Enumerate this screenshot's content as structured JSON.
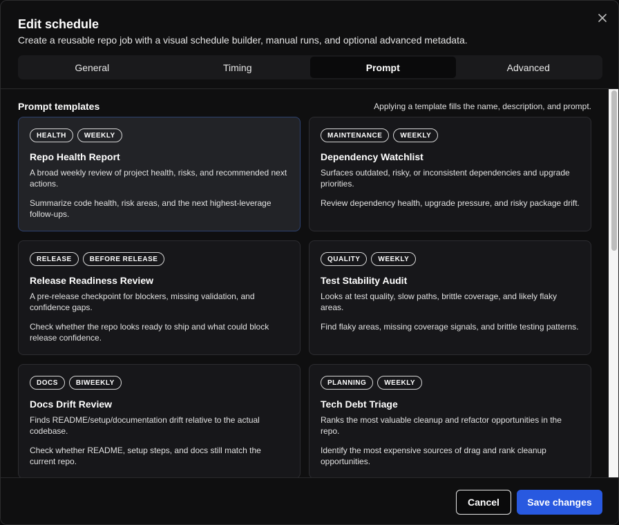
{
  "dialog": {
    "title": "Edit schedule",
    "subtitle": "Create a reusable repo job with a visual schedule builder, manual runs, and optional advanced metadata.",
    "close_icon": "close-icon"
  },
  "tabs": [
    {
      "label": "General",
      "active": false
    },
    {
      "label": "Timing",
      "active": false
    },
    {
      "label": "Prompt",
      "active": true
    },
    {
      "label": "Advanced",
      "active": false
    }
  ],
  "templates_section": {
    "title": "Prompt templates",
    "note": "Applying a template fills the name, description, and prompt."
  },
  "templates": [
    {
      "tags": [
        "HEALTH",
        "WEEKLY"
      ],
      "title": "Repo Health Report",
      "description": "A broad weekly review of project health, risks, and recommended next actions.",
      "prompt": "Summarize code health, risk areas, and the next highest-leverage follow-ups.",
      "selected": true
    },
    {
      "tags": [
        "MAINTENANCE",
        "WEEKLY"
      ],
      "title": "Dependency Watchlist",
      "description": "Surfaces outdated, risky, or inconsistent dependencies and upgrade priorities.",
      "prompt": "Review dependency health, upgrade pressure, and risky package drift.",
      "selected": false
    },
    {
      "tags": [
        "RELEASE",
        "BEFORE RELEASE"
      ],
      "title": "Release Readiness Review",
      "description": "A pre-release checkpoint for blockers, missing validation, and confidence gaps.",
      "prompt": "Check whether the repo looks ready to ship and what could block release confidence.",
      "selected": false
    },
    {
      "tags": [
        "QUALITY",
        "WEEKLY"
      ],
      "title": "Test Stability Audit",
      "description": "Looks at test quality, slow paths, brittle coverage, and likely flaky areas.",
      "prompt": "Find flaky areas, missing coverage signals, and brittle testing patterns.",
      "selected": false
    },
    {
      "tags": [
        "DOCS",
        "BIWEEKLY"
      ],
      "title": "Docs Drift Review",
      "description": "Finds README/setup/documentation drift relative to the actual codebase.",
      "prompt": "Check whether README, setup steps, and docs still match the current repo.",
      "selected": false
    },
    {
      "tags": [
        "PLANNING",
        "WEEKLY"
      ],
      "title": "Tech Debt Triage",
      "description": "Ranks the most valuable cleanup and refactor opportunities in the repo.",
      "prompt": "Identify the most expensive sources of drag and rank cleanup opportunities.",
      "selected": false
    }
  ],
  "footer": {
    "cancel_label": "Cancel",
    "save_label": "Save changes"
  },
  "colors": {
    "primary_button": "#2859e0",
    "selected_card_border": "#2e4270"
  }
}
